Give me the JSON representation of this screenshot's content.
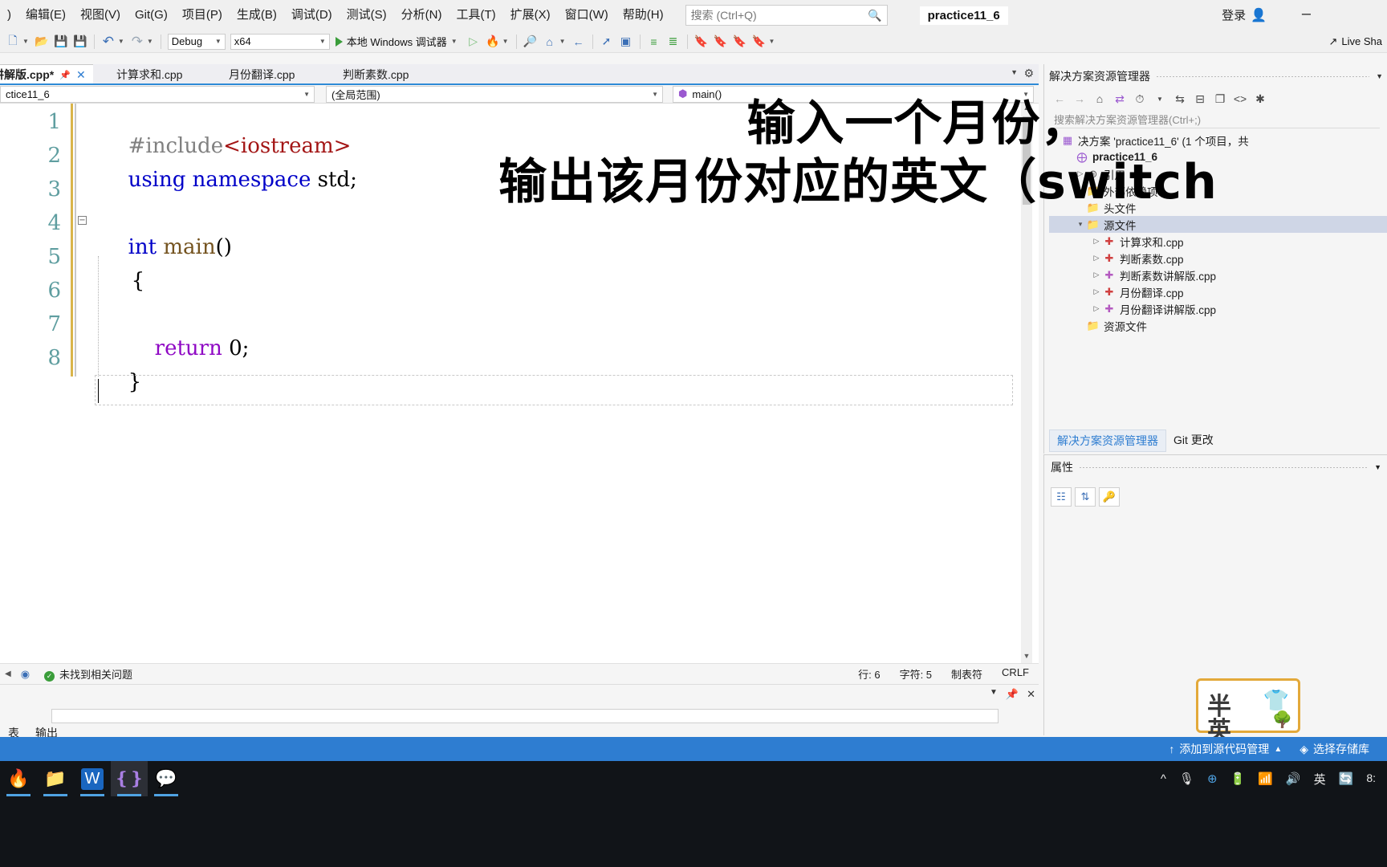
{
  "menu": {
    "items": [
      ")",
      "编辑(E)",
      "视图(V)",
      "Git(G)",
      "项目(P)",
      "生成(B)",
      "调试(D)",
      "测试(S)",
      "分析(N)",
      "工具(T)",
      "扩展(X)",
      "窗口(W)",
      "帮助(H)"
    ],
    "search_placeholder": "搜索 (Ctrl+Q)",
    "search_icon": "search-icon",
    "window_title": "practice11_6",
    "login_label": "登录",
    "login_icon": "account-add-icon",
    "minimize_icon": "minimize-icon"
  },
  "toolbar": {
    "config": "Debug",
    "platform": "x64",
    "run_label": "本地 Windows 调试器",
    "live_share": "Live Sha",
    "icons": [
      "new-project-icon",
      "open-file-icon",
      "save-icon",
      "save-all-icon",
      "undo-icon",
      "redo-icon",
      "start-debug-icon",
      "start-no-debug-icon",
      "hot-reload-icon",
      "find-in-files-icon",
      "home-icon",
      "navigate-back-icon",
      "select-element-icon",
      "comment-icon",
      "uncomment-icon",
      "indent-icon",
      "outdent-icon",
      "bookmark-icon",
      "prev-bookmark-icon",
      "next-bookmark-icon",
      "clear-bookmark-icon"
    ]
  },
  "tabs": {
    "items": [
      {
        "label": "译讲解版.cpp*",
        "active": true,
        "pin_icon": "pin-icon",
        "close_icon": "close-icon"
      },
      {
        "label": "计算求和.cpp",
        "active": false
      },
      {
        "label": "月份翻译.cpp",
        "active": false
      },
      {
        "label": "判断素数.cpp",
        "active": false
      }
    ],
    "overflow_icon": "chevron-down-icon",
    "settings_icon": "gear-icon"
  },
  "navbar": {
    "project": "ctice11_6",
    "scope": "(全局范围)",
    "member": "main()",
    "member_icon": "method-icon",
    "caret_icon": "chevron-down-icon"
  },
  "code": {
    "line_numbers": [
      "1",
      "2",
      "3",
      "4",
      "5",
      "6",
      "7",
      "8"
    ],
    "lines": [
      {
        "n": 1,
        "parts": [
          {
            "t": "#include",
            "c": "kw-pre"
          },
          {
            "t": "<iostream>",
            "c": "kw-str"
          }
        ]
      },
      {
        "n": 2,
        "parts": [
          {
            "t": "using namespace ",
            "c": "kw-blue"
          },
          {
            "t": "std;",
            "c": "kw-blk"
          }
        ]
      },
      {
        "n": 3,
        "parts": []
      },
      {
        "n": 4,
        "parts": [
          {
            "t": "int ",
            "c": "kw-blue"
          },
          {
            "t": "main",
            "c": "kw-fn"
          },
          {
            "t": "()",
            "c": "kw-blk"
          }
        ]
      },
      {
        "n": 5,
        "parts": [
          {
            "t": "{",
            "c": "kw-blk"
          }
        ]
      },
      {
        "n": 6,
        "parts": []
      },
      {
        "n": 7,
        "parts": [
          {
            "t": "    return ",
            "c": "kw-pur"
          },
          {
            "t": "0;",
            "c": "kw-blk"
          }
        ]
      },
      {
        "n": 8,
        "parts": [
          {
            "t": "}",
            "c": "kw-blk"
          }
        ]
      }
    ],
    "fold_glyph": "−"
  },
  "editor_status": {
    "problems": "未找到相关问题",
    "problems_icon": "check-circle-icon",
    "line": "行: 6",
    "col": "字符: 5",
    "tabs": "制表符",
    "eol": "CRLF",
    "nav_left_icon": "chevron-left-icon",
    "nav_pin_icon": "pin-icon"
  },
  "output_panel": {
    "tabs": [
      "表",
      "输出"
    ],
    "caret_icon": "chevron-down-icon",
    "pin_icon": "pin-icon",
    "close_icon": "close-icon"
  },
  "solution_explorer": {
    "title": "解决方案资源管理器",
    "caret_icon": "chevron-down-icon",
    "search_placeholder": "搜索解决方案资源管理器(Ctrl+;)",
    "toolbar_icons": [
      "back-icon",
      "forward-icon",
      "home-icon",
      "sync-with-active-doc-icon",
      "pending-changes-icon",
      "refresh-icon",
      "collapse-all-icon",
      "new-folder-icon",
      "show-all-files-icon",
      "properties-icon"
    ],
    "tree": [
      {
        "depth": 0,
        "expander": "",
        "icon": "solution-icon",
        "label": "决方案 'practice11_6' (1 个项目，共",
        "bold": false,
        "selected": false
      },
      {
        "depth": 1,
        "expander": "",
        "icon": "project-icon",
        "label": "practice11_6",
        "bold": true,
        "selected": false
      },
      {
        "depth": 2,
        "expander": "▷",
        "icon": "references-icon",
        "label": "引用",
        "bold": false,
        "selected": false
      },
      {
        "depth": 2,
        "expander": "▷",
        "icon": "external-deps-icon",
        "label": "外部依赖项",
        "bold": false,
        "selected": false
      },
      {
        "depth": 2,
        "expander": "",
        "icon": "folder-filter-icon",
        "label": "头文件",
        "bold": false,
        "selected": false
      },
      {
        "depth": 2,
        "expander": "◢",
        "icon": "folder-filter-icon",
        "label": "源文件",
        "bold": false,
        "selected": true
      },
      {
        "depth": 3,
        "expander": "▷",
        "icon": "cpp-file-icon",
        "label": "计算求和.cpp",
        "bold": false,
        "selected": false
      },
      {
        "depth": 3,
        "expander": "▷",
        "icon": "cpp-file-icon",
        "label": "判断素数.cpp",
        "bold": false,
        "selected": false
      },
      {
        "depth": 3,
        "expander": "▷",
        "icon": "cpp-file-plus-icon",
        "label": "判断素数讲解版.cpp",
        "bold": false,
        "selected": false
      },
      {
        "depth": 3,
        "expander": "▷",
        "icon": "cpp-file-icon",
        "label": "月份翻译.cpp",
        "bold": false,
        "selected": false
      },
      {
        "depth": 3,
        "expander": "▷",
        "icon": "cpp-file-plus-icon",
        "label": "月份翻译讲解版.cpp",
        "bold": false,
        "selected": false
      },
      {
        "depth": 2,
        "expander": "",
        "icon": "folder-filter-icon",
        "label": "资源文件",
        "bold": false,
        "selected": false
      }
    ],
    "bottom_tabs": [
      {
        "label": "解决方案资源管理器",
        "active": true
      },
      {
        "label": "Git 更改",
        "active": false
      }
    ]
  },
  "properties": {
    "title": "属性",
    "caret_icon": "chevron-down-icon",
    "toolbar_icons": [
      "categorized-icon",
      "alphabetical-icon",
      "properties-key-icon"
    ]
  },
  "overlay": {
    "line1": "输入一个月份，",
    "line2": "输出该月份对应的英文（switch"
  },
  "sticker": {
    "top": "半",
    "bottom": "英",
    "shirt_icon": "shirt-icon",
    "tree_icon": "tree-icon"
  },
  "vs_bottom_bar": {
    "source_control": "添加到源代码管理",
    "source_control_icon": "arrow-up-icon",
    "source_control_caret": "▲",
    "repo": "选择存储库",
    "repo_icon": "git-icon"
  },
  "taskbar": {
    "apps": [
      "firefox-icon",
      "file-explorer-icon",
      "wps-icon",
      "visual-studio-icon",
      "wechat-icon"
    ],
    "tray": [
      "chevron-up-icon",
      "microphone-icon",
      "update-icon",
      "battery-icon",
      "wifi-icon",
      "volume-icon"
    ],
    "ime": "英",
    "ime_app_icon": "sogou-icon",
    "clock": "8:"
  },
  "colors": {
    "accent": "#2e7dd1",
    "keyword": "#0000c8",
    "string": "#a31515",
    "preproc": "#808080",
    "function": "#74531f",
    "control": "#8f08c4",
    "linenum": "#5f9ea0",
    "selection": "#cfd6e6",
    "taskbar": "#111418"
  }
}
